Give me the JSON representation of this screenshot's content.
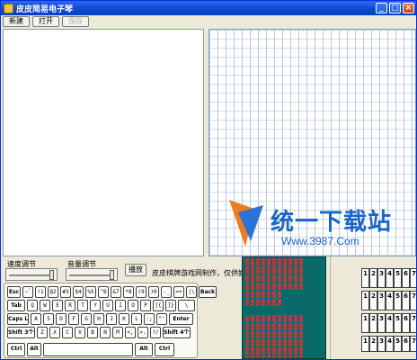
{
  "window": {
    "title": "皮皮简易电子琴"
  },
  "toolbar": {
    "new_label": "新建",
    "open_label": "打开",
    "save_label": "保存"
  },
  "watermark": {
    "text": "统一下载站",
    "url": "Www.3987.Com"
  },
  "controls": {
    "speed_label": "速度调节",
    "volume_label": "音量调节",
    "play_label": "播放",
    "speed_value": 0.95,
    "volume_value": 0.95
  },
  "credit": "皮皮棋牌游戏网制作，仅供娱乐",
  "keyboard": {
    "row1": [
      "Esc",
      "~`",
      "!1",
      "@2",
      "#3",
      "$4",
      "%5",
      "^6",
      "&7",
      "*8",
      "(9",
      ")0",
      "-_",
      "=+",
      "|\\",
      "Back"
    ],
    "row2": [
      "Tab",
      "Q",
      "W",
      "E",
      "R",
      "T",
      "Y",
      "U",
      "I",
      "O",
      "P",
      "[{",
      "]}",
      "\\"
    ],
    "row3": [
      "Caps Lock",
      "A",
      "S",
      "D",
      "F",
      "G",
      "H",
      "J",
      "K",
      "L",
      ":;",
      "\"'",
      "Enter"
    ],
    "row4": [
      "Shift 3个一",
      "Z",
      "X",
      "C",
      "V",
      "B",
      "N",
      "M",
      "<,",
      ">.",
      "?/",
      "Shift 4个一"
    ],
    "row5": [
      "Ctrl",
      "Alt",
      "",
      "Alt",
      "Ctrl"
    ]
  },
  "notebuttons": [
    "1",
    "2",
    "3",
    "4",
    "5",
    "6",
    "7"
  ]
}
